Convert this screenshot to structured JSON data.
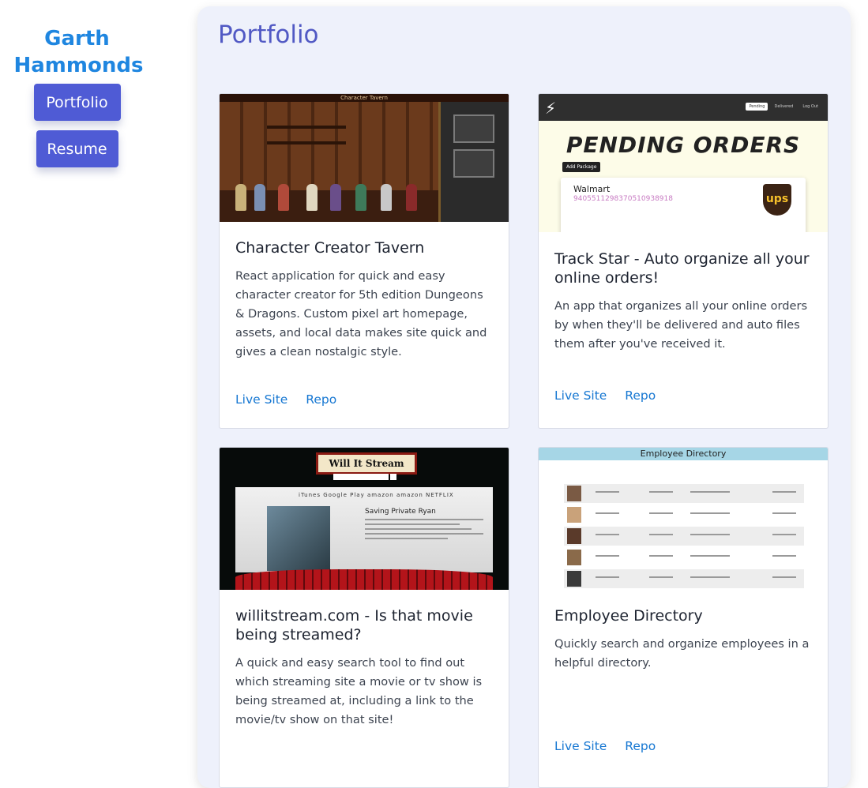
{
  "sidebar": {
    "name": "Garth Hammonds",
    "nav": [
      {
        "label": "Portfolio"
      },
      {
        "label": "Resume"
      }
    ]
  },
  "main": {
    "title": "Portfolio",
    "cards": [
      {
        "title": "Character Creator Tavern",
        "description": "React application for quick and easy character creator for 5th edition Dungeons & Dragons. Custom pixel art homepage, assets, and local data makes site quick and gives a clean nostalgic style.",
        "links": [
          "Live Site",
          "Repo"
        ],
        "image": {
          "banner": "Character Tavern"
        }
      },
      {
        "title": "Track Star - Auto organize all your online orders!",
        "description": "An app that organizes all your online orders by when they'll be delivered and auto files them after you've received it.",
        "links": [
          "Live Site",
          "Repo"
        ],
        "image": {
          "heading": "PENDING ORDERS",
          "add_button": "Add Package",
          "tabs": [
            "Pending",
            "Delivered",
            "Log Out"
          ],
          "store": "Walmart",
          "tracking": "9405511298370510938918",
          "carrier": "ups"
        }
      },
      {
        "title": "willitstream.com - Is that movie being streamed?",
        "description": "A quick and easy search tool to find out which streaming site a movie or tv show is being streamed at, including a link to the movie/tv show on that site!",
        "links": [
          "Live Site",
          "Repo"
        ],
        "image": {
          "logo": "Will It Stream",
          "brands": "iTunes  Google Play  amazon  amazon  NETFLIX",
          "movie": "Saving Private Ryan"
        }
      },
      {
        "title": "Employee Directory",
        "description": "Quickly search and organize employees in a helpful directory.",
        "links": [
          "Live Site",
          "Repo"
        ],
        "image": {
          "heading": "Employee Directory"
        }
      }
    ]
  }
}
